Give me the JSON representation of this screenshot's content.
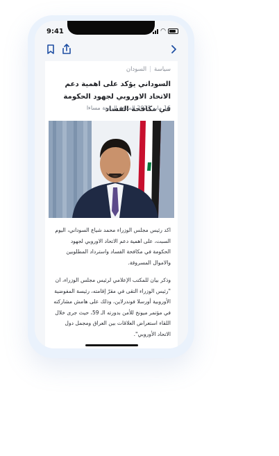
{
  "status_bar": {
    "time": "9:41"
  },
  "article": {
    "category": "سياسة",
    "subcategory": "السودان",
    "title": "السوداني يؤكد على اهمية دعم الاتحاد الاوروبي لجهود الحكومة في مكافحة الفساد",
    "date": "16 مايو 2023 الساعة الرابعة مساءا",
    "paragraphs": [
      "اكد رئيس مجلس الوزراء محمد شياع السوداني، اليوم السبت، على اهمية دعم الاتحاد الاوروبي لجهود الحكومة في مكافحة الفساد واسترداد المطلوبين والاموال المسروقة.",
      "وذكر بيان للمكتب الإعلامي لرئيس مجلس الوزراء، ان \"رئيس الوزراء التقى في مقرّ إقامته، رئيسة المفوضية الأوروبية أورسلا فوندرلاين، وذلك على هامش مشاركته في مؤتمر ميونخ للأمن بدورته الـ 59، حيث جرى خلال اللقاء استعراض العلاقات بين العراق ومجمل دول الاتحاد الأوروبي\"."
    ]
  },
  "colors": {
    "accent": "#1f4fa3",
    "flag_red": "#c8102e",
    "flag_green": "#007a3d"
  },
  "icons": {
    "bookmark": "bookmark-icon",
    "share": "share-icon",
    "back": "chevron-right-icon"
  }
}
